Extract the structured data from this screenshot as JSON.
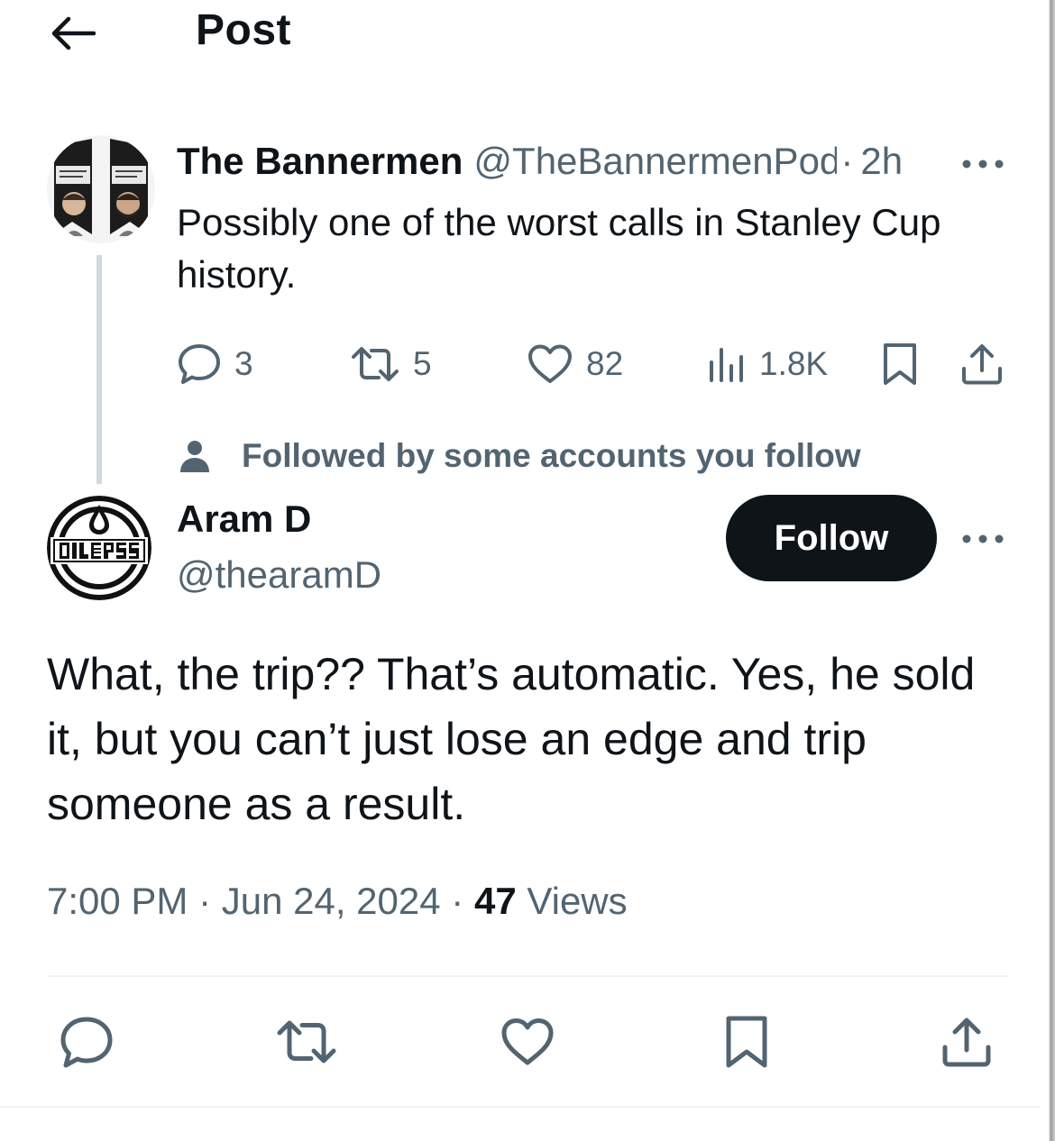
{
  "header": {
    "back_icon": "arrow-left-icon",
    "title": "Post"
  },
  "parent_post": {
    "author_name": "The Bannermen",
    "author_handle": "@TheBannermenPod",
    "separator": "·",
    "time_ago": "2h",
    "avatar_icon": "bannermen-podcast-avatar",
    "more_icon": "more-horizontal-icon",
    "text": "Possibly one of the worst calls in Stanley Cup history.",
    "stats": {
      "replies": "3",
      "reposts": "5",
      "likes": "82",
      "views": "1.8K"
    },
    "action_icons": [
      "reply-icon",
      "repost-icon",
      "like-icon",
      "views-icon",
      "bookmark-icon",
      "share-icon"
    ]
  },
  "social_context": {
    "icon": "person-icon",
    "text": "Followed by some accounts you follow"
  },
  "main_post": {
    "author_name": "Aram D",
    "author_handle": "@thearamD",
    "avatar_icon": "oilers-logo-avatar",
    "follow_label": "Follow",
    "more_icon": "more-horizontal-icon",
    "text": "What, the trip??  That’s automatic.  Yes, he sold it, but you can’t just lose an edge and trip someone as a result.",
    "timestamp": "7:00 PM · Jun 24, 2024",
    "separator": "·",
    "views_count": "47",
    "views_label": "Views"
  },
  "bottom_actions": [
    "reply-icon",
    "repost-icon",
    "like-icon",
    "bookmark-icon",
    "share-icon"
  ],
  "colors": {
    "text_primary": "#0f1419",
    "text_secondary": "#536471",
    "divider": "#eff3f4",
    "thread_line": "#cfd9de",
    "follow_bg": "#0f1419"
  }
}
